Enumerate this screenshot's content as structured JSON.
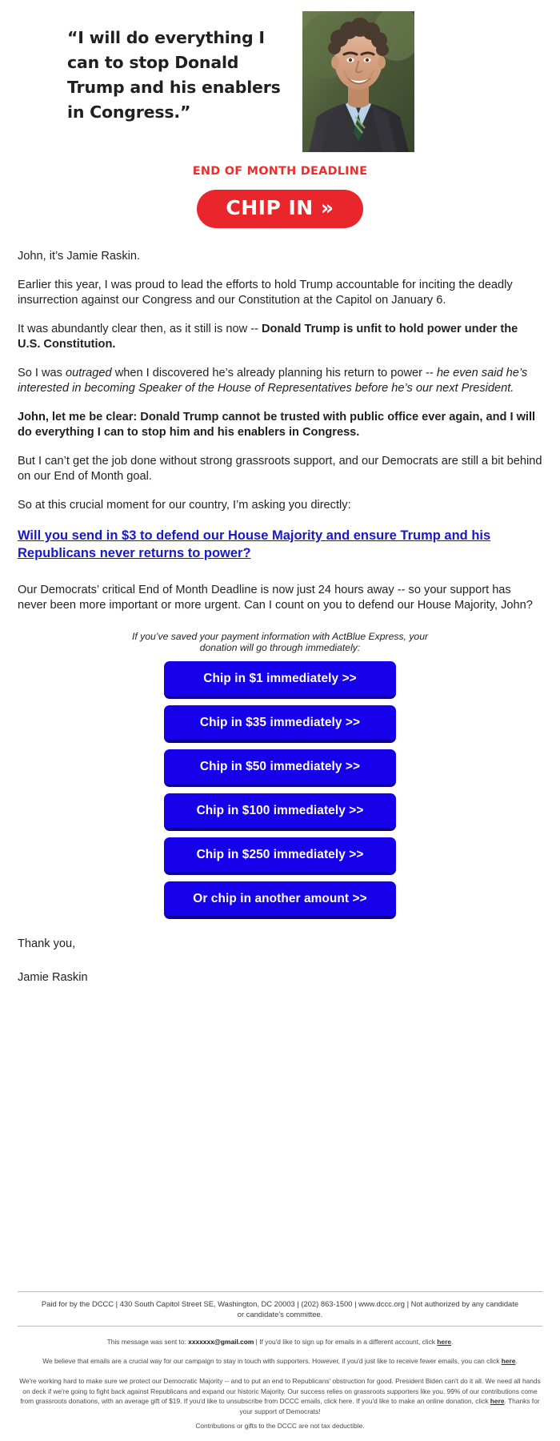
{
  "hero": {
    "quote": "“I will do everything I can to stop Donald Trump and his enablers in Congress.”",
    "photo_alt": "jamie-raskin-portrait"
  },
  "deadline_banner": {
    "text": "END OF MONTH DEADLINE"
  },
  "cta": {
    "label": "CHIP IN »",
    "color": "#E8262B"
  },
  "letter": {
    "greeting": "John, it’s Jamie Raskin.",
    "p1": "Earlier this year, I was proud to lead the efforts to hold Trump accountable for inciting the deadly insurrection against our Congress and our Constitution at the Capitol on January 6.",
    "p2_lead": "It was abundantly clear then, as it still is now -- ",
    "p2_bold": "Donald Trump is unfit to hold power under the U.S. Constitution.",
    "p3_a": "So I was ",
    "p3_italic1": "outraged",
    "p3_b": " when I discovered he’s already planning his return to power -- ",
    "p3_italic2": "he even said he’s interested in becoming Speaker of the House of Representatives before he’s our next President.",
    "p4_bold": "John, let me be clear: Donald Trump cannot be trusted with public office ever again, and I will do everything I can to stop him and his enablers in Congress.",
    "p5": "But I can’t get the job done without strong grassroots support, and our Democrats are still a bit behind on our End of Month goal.",
    "p6": "So at this crucial moment for our country, I’m asking you directly:",
    "ask_link": "Will you send in $3 to defend our House Majority and ensure Trump and his Republicans never returns to power?",
    "p7": "Our Democrats’ critical End of Month Deadline is now just 24 hours away -- so your support has never been more important or more urgent. Can I count on you to defend our House Majority, John?",
    "closing": "Thank you,",
    "signature": "Jamie Raskin"
  },
  "actblue_note": "If you’ve saved your payment information with ActBlue Express, your donation will go through immediately:",
  "donate_buttons": [
    {
      "label": "Chip in $1 immediately >>",
      "amount": "$1"
    },
    {
      "label": "Chip in $35 immediately >>",
      "amount": "$35"
    },
    {
      "label": "Chip in $50 immediately >>",
      "amount": "$50"
    },
    {
      "label": "Chip in $100 immediately >>",
      "amount": "$100"
    },
    {
      "label": "Chip in $250 immediately >>",
      "amount": "$250"
    },
    {
      "label": "Or chip in another amount >>",
      "amount": "other"
    }
  ],
  "donate_button_color": "#1500E9",
  "footer": {
    "paid_for": "Paid for by the DCCC | 430 South Capitol Street SE, Washington, DC 20003 | (202) 863-1500 | www.dccc.org | Not authorized by any candidate or candidate's committee.",
    "sent_to_prefix": "This message was sent to: ",
    "sent_to_email": "xxxxxxx@gmail.com",
    "sent_to_suffix_a": " | If you'd like to sign up for emails in a different account, click ",
    "sent_to_link": "here",
    "sent_to_suffix_b": ".",
    "fewer_emails_a": "We believe that emails are a crucial way for our campaign to stay in touch with supporters. However, if you'd just like to receive fewer emails, you can click ",
    "fewer_emails_link": "here",
    "fewer_emails_b": ".",
    "long_a": "We're working hard to make sure we protect our Democratic Majority -- and to put an end to Republicans' obstruction for good. President Biden can't do it all. We need all hands on deck if we're going to fight back against Republicans and expand our historic Majority. Our success relies on grassroots supporters like you. 99% of our contributions come from grassroots donations, with an average gift of $19. If you'd like to unsubscribe from DCCC emails, click here. If you'd like to make an online donation, click ",
    "long_link": "here",
    "long_b": ".",
    "long_thanks": "Thanks for your support of Democrats!",
    "tax_note": "Contributions or gifts to the DCCC are not tax deductible."
  }
}
